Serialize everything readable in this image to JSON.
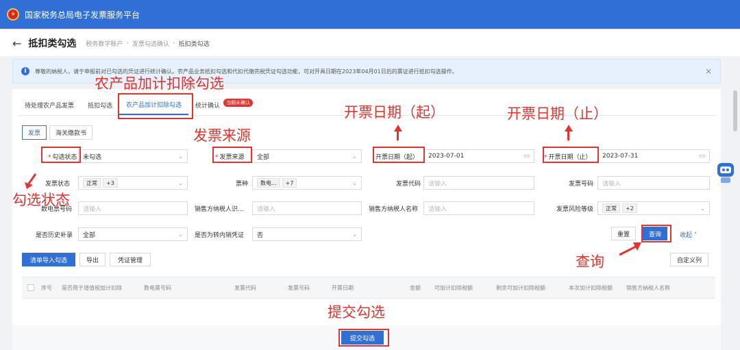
{
  "header": {
    "app_title": "国家税务总局电子发票服务平台"
  },
  "page": {
    "title": "抵扣类勾选",
    "breadcrumb": [
      "税务数字账户",
      "发票勾选确认",
      "抵扣类勾选"
    ]
  },
  "notice": {
    "text": "尊敬的纳税人，请于申报前对已勾选的凭证进行统计确认。农产品业务抵扣勾选和代扣代缴完税凭证勾选功能，可对开具日期在2023年04月01日后的票证进行抵扣勾选操作。",
    "close": "×"
  },
  "tabs": [
    {
      "label": "待处理农产品发票"
    },
    {
      "label": "抵扣勾选"
    },
    {
      "label": "农产品加计扣除勾选",
      "active": true
    },
    {
      "label": "统计确认",
      "badge": "当期未确认"
    }
  ],
  "subtabs": [
    {
      "label": "发票",
      "active": true
    },
    {
      "label": "海关缴款书"
    }
  ],
  "filters": {
    "select_status": {
      "label": "勾选状态",
      "value": "未勾选"
    },
    "invoice_source": {
      "label": "发票来源",
      "value": "全部"
    },
    "date_start": {
      "label": "开票日期（起）",
      "value": "2023-07-01"
    },
    "date_end": {
      "label": "开票日期（止）",
      "value": "2023-07-31"
    },
    "invoice_status": {
      "label": "发票状态",
      "tag": "正常",
      "more": "+3"
    },
    "invoice_type": {
      "label": "票种",
      "tag": "数电...",
      "more": "+7"
    },
    "invoice_code": {
      "label": "发票代码",
      "placeholder": "请输入"
    },
    "invoice_number": {
      "label": "发票号码",
      "placeholder": "请输入"
    },
    "digital_number": {
      "label": "数电票号码",
      "placeholder": "请输入"
    },
    "seller_tax_id": {
      "label": "销售方纳税人识...",
      "placeholder": "请输入"
    },
    "seller_name": {
      "label": "销售方纳税人名称",
      "placeholder": "请输入"
    },
    "risk_level": {
      "label": "发票风险等级",
      "tag": "正常",
      "more": "+2"
    },
    "history_makeup": {
      "label": "是否历史补录",
      "value": "全部"
    },
    "domestic_transfer": {
      "label": "是否为转内销凭证",
      "value": "否"
    }
  },
  "actions": {
    "reset": "重置",
    "query": "查询",
    "collapse": "收起",
    "import_select": "清单导入勾选",
    "export": "导出",
    "voucher_manage": "凭证管理",
    "custom_columns": "自定义列",
    "submit": "提交勾选"
  },
  "table": {
    "columns": [
      "序号",
      "是否用于增值税加计扣除",
      "数电票号码",
      "发票代码",
      "发票号码",
      "开票日期",
      "金额",
      "可加计扣除税额",
      "剩余可加计扣除税额",
      "本次加计扣除税额",
      "销售方纳税人名称"
    ]
  },
  "annotations": {
    "tab": "农产品加计扣除勾选",
    "source": "发票来源",
    "date_start": "开票日期（起）",
    "date_end": "开票日期（止）",
    "status": "勾选状态",
    "query": "查询",
    "submit": "提交勾选"
  },
  "colors": {
    "primary": "#2f6fd6",
    "annotation": "#e5322d"
  }
}
